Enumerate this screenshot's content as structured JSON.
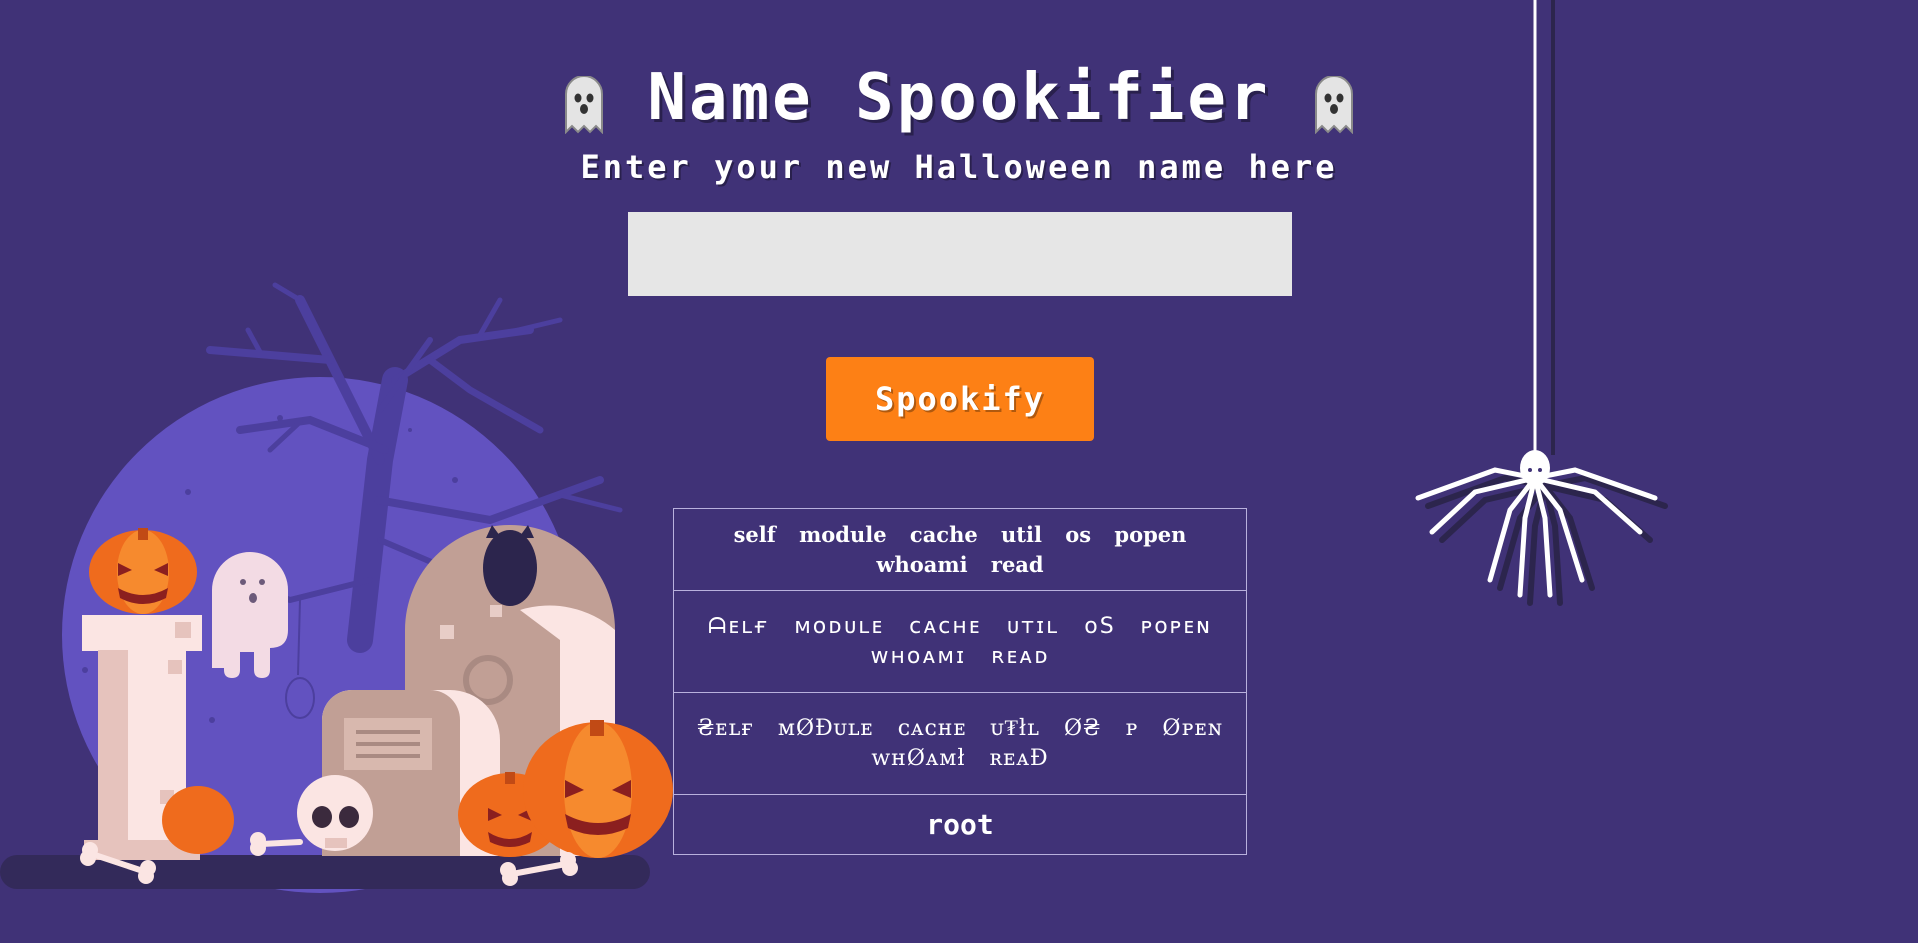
{
  "header": {
    "title": "Name Spookifier",
    "subtitle": "Enter your new Halloween name here",
    "left_icon": "ghost-icon",
    "right_icon": "ghost-icon"
  },
  "form": {
    "name_input_value": "",
    "name_input_placeholder": "",
    "submit_label": "Spookify"
  },
  "results": [
    "self module cache util os popen whoami read",
    "ᗩᴇʟғ ᴍᴏᴅᴜʟᴇ ᴄᴀᴄʜᴇ ᴜᴛɪʟ ᴏS ᴘᴏᴘᴇɴ ᴡʜᴏᴀᴍɪ ʀᴇᴀᴅ",
    "₴ᴇʟғ ᴍØĐᴜʟᴇ ᴄᴀᴄʜᴇ ᴜ₮łʟ Ø₴ ᴘ Øᴘᴇɴ ᴡʜØᴀᴍł ʀᴇᴀĐ",
    "root"
  ],
  "colors": {
    "background": "#403277",
    "button": "#fd8015",
    "input": "#e6e6e6",
    "moon": "#6252c0",
    "pumpkin": "#ef6b1d"
  },
  "illustration": {
    "left_scene": "halloween-graveyard-illustration",
    "right_decoration": "hanging-spider-icon"
  }
}
